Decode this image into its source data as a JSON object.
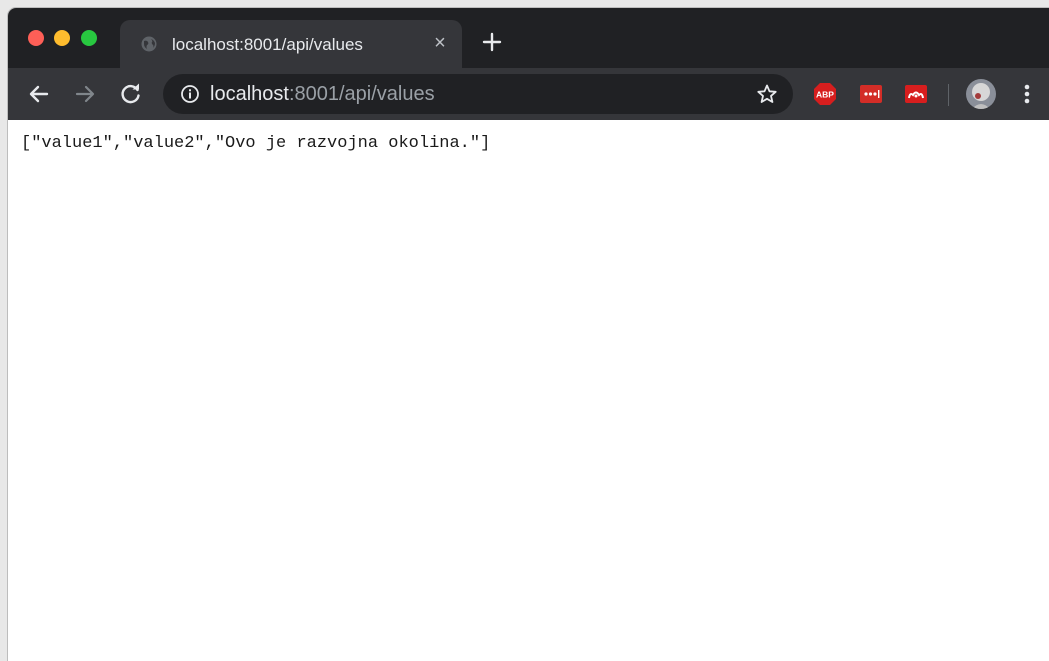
{
  "browser": {
    "tab": {
      "title": "localhost:8001/api/values",
      "favicon": "globe-icon",
      "close": "×"
    },
    "toolbar": {
      "url_host": "localhost",
      "url_rest": ":8001/api/values"
    },
    "extensions": [
      {
        "name": "adblock-plus-icon",
        "label": "ABP",
        "color": "#d71e1e"
      },
      {
        "name": "lastpass-icon",
        "label": "•••|",
        "color": "#d32d27"
      },
      {
        "name": "mendeley-icon",
        "label": "",
        "color": "#d71e1e"
      }
    ]
  },
  "content": {
    "body_text": "[\"value1\",\"value2\",\"Ovo je razvojna okolina.\"]"
  },
  "colors": {
    "tabstrip": "#202124",
    "toolbar": "#35363a",
    "omnibox": "#202124"
  }
}
